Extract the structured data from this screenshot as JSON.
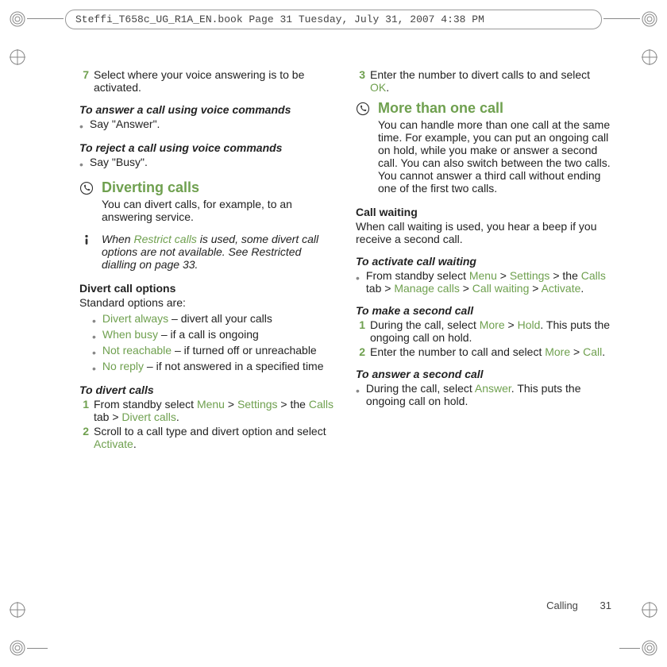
{
  "header": {
    "filename_line": "Steffi_T658c_UG_R1A_EN.book  Page 31  Tuesday, July 31, 2007  4:38 PM"
  },
  "left": {
    "step7_num": "7",
    "step7_text": "Select where your voice answering is to be activated.",
    "answer_head": "To answer a call using voice commands",
    "answer_bullet": "Say \"Answer\".",
    "reject_head": "To reject a call using voice commands",
    "reject_bullet": "Say \"Busy\".",
    "divert_title": "Diverting calls",
    "divert_intro": "You can divert calls, for example, to an answering service.",
    "note_pre": "When ",
    "note_menu": "Restrict calls",
    "note_post": " is used, some divert call options are not available. See Restricted dialling on page 33.",
    "opts_head": "Divert call options",
    "opts_sub": "Standard options are:",
    "opt1_menu": "Divert always",
    "opt1_post": " – divert all your calls",
    "opt2_menu": "When busy",
    "opt2_post": " – if a call is ongoing",
    "opt3_menu": "Not reachable",
    "opt3_post": " – if turned off or unreachable",
    "opt4_menu": "No reply",
    "opt4_post": " – if not answered in a specified time",
    "todivert_head": "To divert calls",
    "d1_num": "1",
    "d1_pre": "From standby select ",
    "d1_m1": "Menu",
    "d1_s1": " > ",
    "d1_m2": "Settings",
    "d1_s2": " > the ",
    "d1_m3": "Calls",
    "d1_s3": " tab > ",
    "d1_m4": "Divert calls",
    "d1_end": ".",
    "d2_num": "2",
    "d2_pre": "Scroll to a call type and divert option and select ",
    "d2_m1": "Activate",
    "d2_end": "."
  },
  "right": {
    "d3_num": "3",
    "d3_pre": "Enter the number to divert calls to and select ",
    "d3_m1": "OK",
    "d3_end": ".",
    "more_title": "More than one call",
    "more_body": "You can handle more than one call at the same time. For example, you can put an ongoing call on hold, while you make or answer a second call. You can also switch between the two calls. You cannot answer a third call without ending one of the first two calls.",
    "cw_head": "Call waiting",
    "cw_body": "When call waiting is used, you hear a beep if you receive a second call.",
    "act_head": "To activate call waiting",
    "act_pre": "From standby select ",
    "act_m1": "Menu",
    "act_s1": " > ",
    "act_m2": "Settings",
    "act_s2": " > the ",
    "act_m3": "Calls",
    "act_s3": " tab > ",
    "act_m4": "Manage calls",
    "act_s4": " > ",
    "act_m5": "Call waiting",
    "act_s5": " > ",
    "act_m6": "Activate",
    "act_end": ".",
    "make_head": "To make a second call",
    "m1_num": "1",
    "m1_pre": "During the call, select ",
    "m1_m1": "More",
    "m1_s1": " > ",
    "m1_m2": "Hold",
    "m1_post": ". This puts the ongoing call on hold.",
    "m2_num": "2",
    "m2_pre": "Enter the number to call and select ",
    "m2_m1": "More",
    "m2_s1": " > ",
    "m2_m2": "Call",
    "m2_end": ".",
    "ans_head": "To answer a second call",
    "ans_pre": "During the call, select ",
    "ans_m1": "Answer",
    "ans_post": ". This puts the ongoing call on hold."
  },
  "footer": {
    "section": "Calling",
    "page": "31"
  }
}
